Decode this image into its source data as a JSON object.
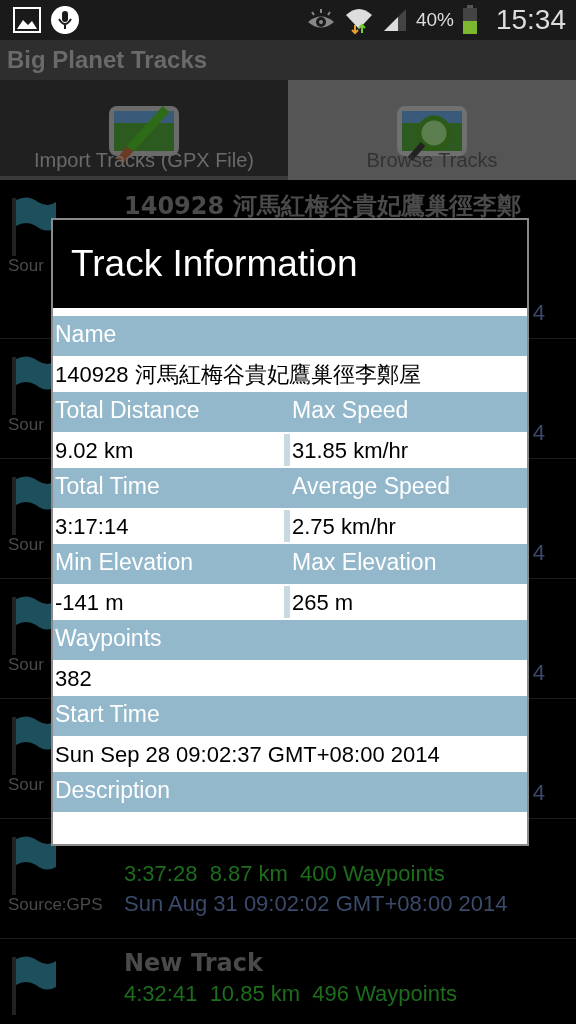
{
  "status_bar": {
    "battery_text": "40%",
    "time": "15:34"
  },
  "app_bar": {
    "title": "Big Planet Tracks"
  },
  "tabs": [
    {
      "label": "Import Tracks (GPX File)",
      "selected": false,
      "kind": "import"
    },
    {
      "label": "Browse Tracks",
      "selected": true,
      "kind": "browse"
    }
  ],
  "tracks": [
    {
      "title": "140928 河馬紅梅谷貴妃鷹巢徑李鄭",
      "source": "Sour",
      "date": "4"
    },
    {
      "source": "Sour",
      "date": "4"
    },
    {
      "source": "Sour",
      "date": "4"
    },
    {
      "source": "Sour",
      "date": "4"
    },
    {
      "source": "Sour",
      "date": "4"
    },
    {
      "stats": "3:37:28  8.87 km  400 Waypoints",
      "source": "Source:GPS",
      "date": "Sun Aug 31 09:02:02 GMT+08:00 2014"
    },
    {
      "title": "New Track",
      "stats": "4:32:41  10.85 km  496 Waypoints"
    }
  ],
  "dialog": {
    "title": "Track Information",
    "fields": [
      {
        "kind": "full",
        "label": "Name",
        "value": "140928 河馬紅梅谷貴妃鷹巢徑李鄭屋"
      },
      {
        "kind": "pair",
        "items": [
          {
            "label": "Total Distance",
            "value": "9.02 km"
          },
          {
            "label": "Max Speed",
            "value": "31.85 km/hr"
          }
        ]
      },
      {
        "kind": "pair",
        "items": [
          {
            "label": "Total Time",
            "value": "3:17:14"
          },
          {
            "label": "Average Speed",
            "value": "2.75 km/hr"
          }
        ]
      },
      {
        "kind": "pair",
        "items": [
          {
            "label": "Min Elevation",
            "value": "-141 m"
          },
          {
            "label": "Max Elevation",
            "value": "265 m"
          }
        ]
      },
      {
        "kind": "full",
        "label": "Waypoints",
        "value": "382"
      },
      {
        "kind": "full",
        "label": "Start Time",
        "value": "Sun Sep 28 09:02:37 GMT+08:00 2014"
      },
      {
        "kind": "full",
        "label": "Description"
      }
    ]
  }
}
